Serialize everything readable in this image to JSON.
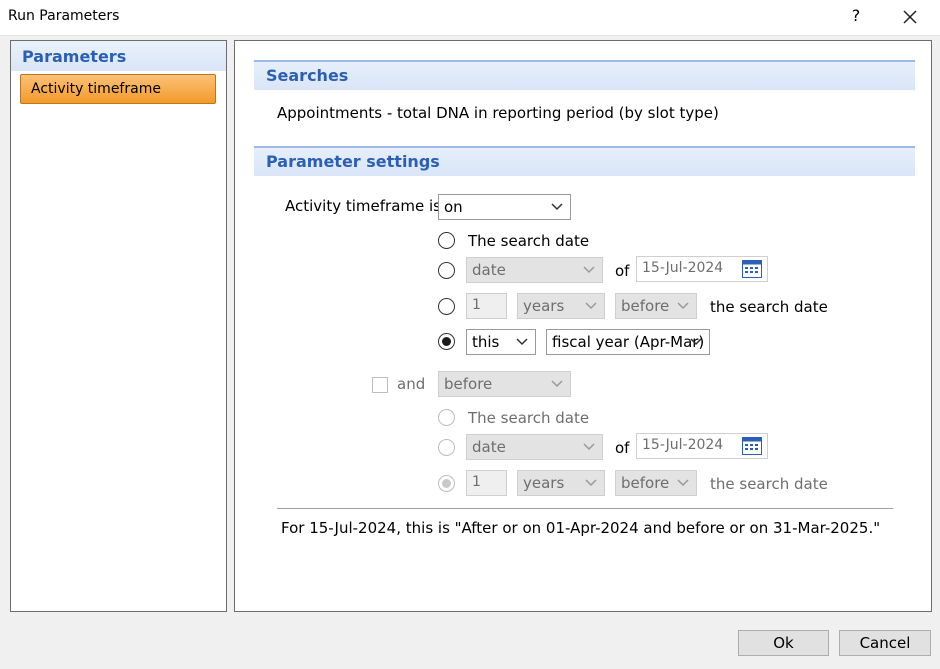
{
  "window": {
    "title": "Run Parameters",
    "help_label": "?"
  },
  "sidebar": {
    "header": "Parameters",
    "items": [
      {
        "label": "Activity timeframe",
        "selected": true
      }
    ]
  },
  "searches": {
    "header": "Searches",
    "text": "Appointments - total DNA in reporting period (by slot type)"
  },
  "params": {
    "header": "Parameter settings",
    "activity_label": "Activity timeframe is",
    "activity_value": "on",
    "block1": {
      "opt1_label": "The search date",
      "date_select": "date",
      "of_label": "of",
      "date_value": "15-Jul-2024",
      "number_value": "1",
      "unit_select": "years",
      "relation_select": "before",
      "search_date_label": "the search date",
      "this_select": "this",
      "period_select": "fiscal year (Apr-Mar)",
      "selected_option": 4
    },
    "and_label": "and",
    "and_checked": false,
    "and_select": "before",
    "block2": {
      "opt1_label": "The search date",
      "date_select": "date",
      "of_label": "of",
      "date_value": "15-Jul-2024",
      "number_value": "1",
      "unit_select": "years",
      "relation_select": "before",
      "search_date_label": "the search date"
    },
    "summary": "For 15-Jul-2024, this is \"After or on 01-Apr-2024 and before or on 31-Mar-2025.\""
  },
  "buttons": {
    "ok": "Ok",
    "cancel": "Cancel"
  },
  "colors": {
    "accent": "#2b5fb4",
    "selected_item": "#f7a541",
    "header_bg": "#d9e6f7"
  }
}
